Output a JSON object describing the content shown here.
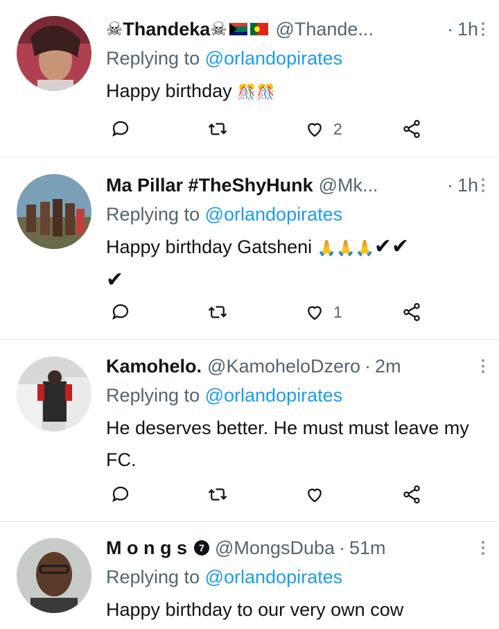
{
  "tweets": [
    {
      "name": "☠Thandeka☠",
      "handle": "@Thande...",
      "dot": "·",
      "time": "1h",
      "replying_prefix": "Replying to ",
      "replying_mention": "@orlandopirates",
      "text": "Happy birthday",
      "emojis": "🎊🎊",
      "reply_count": "",
      "retweet_count": "",
      "like_count": "2"
    },
    {
      "name": "Ma Pillar #TheShyHunk",
      "handle": "@Mk...",
      "dot": "·",
      "time": "1h",
      "replying_prefix": "Replying to ",
      "replying_mention": "@orlandopirates",
      "text": "Happy birthday Gatsheni",
      "emojis": "🙏🙏🙏",
      "checks_line1": "✔✔",
      "checks_line2": "✔",
      "reply_count": "",
      "retweet_count": "",
      "like_count": "1"
    },
    {
      "name": "Kamohelo.",
      "handle": "@KamoheloDzero",
      "dot": "·",
      "time": "2m",
      "replying_prefix": "Replying to ",
      "replying_mention": "@orlandopirates",
      "text": "He deserves better. He must must leave my FC.",
      "reply_count": "",
      "retweet_count": "",
      "like_count": ""
    },
    {
      "name": "M o n g s",
      "badge": "7",
      "handle": "@MongsDuba",
      "dot": "·",
      "time": "51m",
      "replying_prefix": "Replying to ",
      "replying_mention": "@orlandopirates",
      "text": "Happy birthday to our very own cow"
    }
  ],
  "colors": {
    "link": "#1d9bf0",
    "muted": "#536471",
    "text": "#0f1419",
    "divider": "#e6ecf0"
  },
  "icons": [
    "reply-icon",
    "retweet-icon",
    "like-icon",
    "share-icon",
    "more-icon"
  ]
}
